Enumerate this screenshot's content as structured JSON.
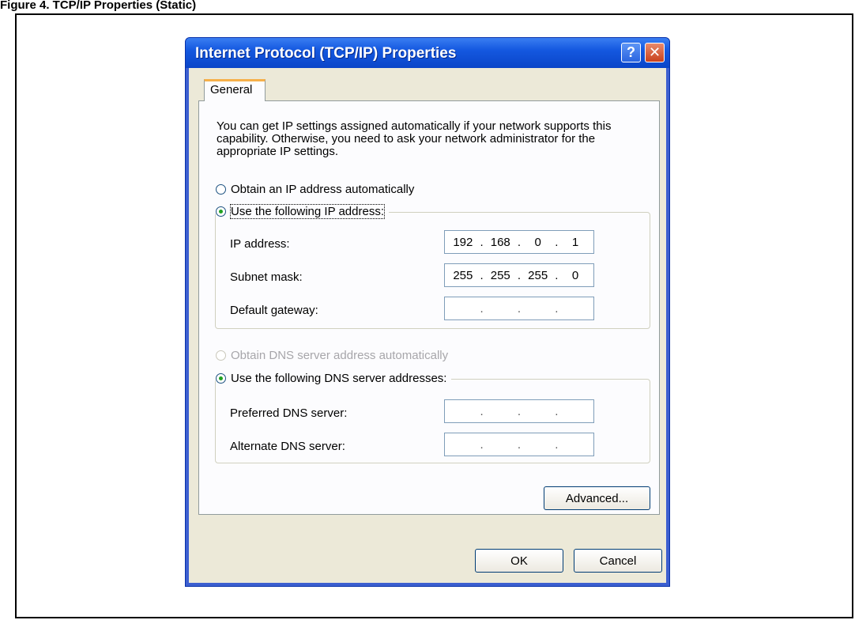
{
  "caption": "Figure 4. TCP/IP Properties (Static)",
  "dialog": {
    "title": "Internet Protocol (TCP/IP) Properties",
    "help_glyph": "?",
    "close_glyph": "✕",
    "tab_label": "General",
    "intro": "You can get IP settings assigned automatically if your network supports this capability. Otherwise, you need to ask your network administrator for the appropriate IP settings.",
    "ip": {
      "auto_label": "Obtain an IP address automatically",
      "manual_label": "Use the following IP address:",
      "selected": "manual",
      "fields": [
        {
          "label": "IP address:",
          "octets": [
            "192",
            "168",
            "0",
            "1"
          ]
        },
        {
          "label": "Subnet mask:",
          "octets": [
            "255",
            "255",
            "255",
            "0"
          ]
        },
        {
          "label": "Default gateway:",
          "octets": [
            "",
            "",
            "",
            ""
          ]
        }
      ]
    },
    "dns": {
      "auto_label": "Obtain DNS server address automatically",
      "auto_disabled": true,
      "manual_label": "Use the following DNS server addresses:",
      "selected": "manual",
      "fields": [
        {
          "label": "Preferred DNS server:",
          "octets": [
            "",
            "",
            "",
            ""
          ]
        },
        {
          "label": "Alternate DNS server:",
          "octets": [
            "",
            "",
            "",
            ""
          ]
        }
      ]
    },
    "advanced_label": "Advanced...",
    "ok_label": "OK",
    "cancel_label": "Cancel"
  },
  "colors": {
    "titlebar": "#0a45c8",
    "dialog_face": "#ece9d8",
    "radio_dot": "#21a121",
    "close_button": "#c9411c"
  }
}
